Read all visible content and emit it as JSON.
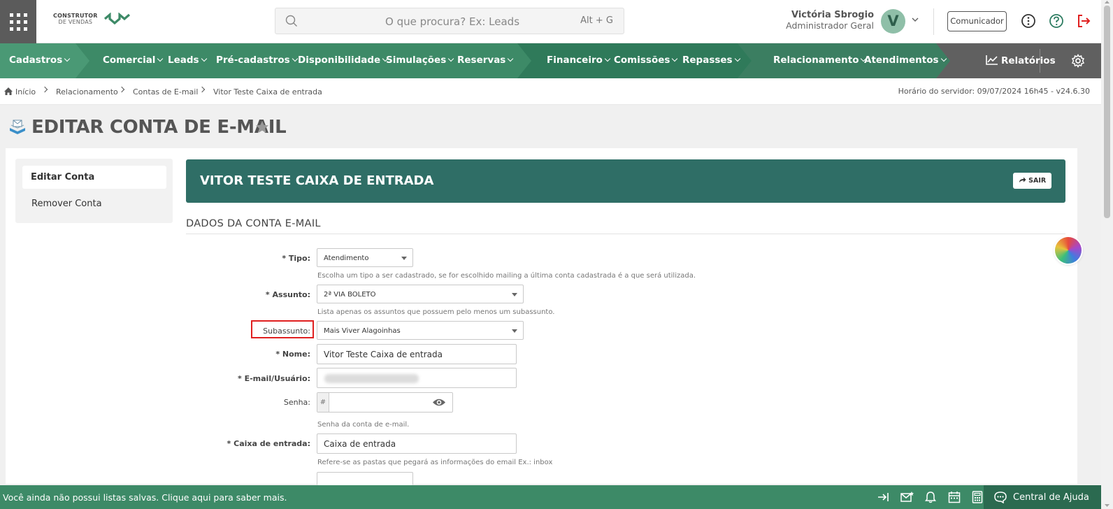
{
  "header": {
    "logo_line1": "CONSTRUTOR",
    "logo_line2": "DE VENDAS",
    "search_placeholder": "O que procura? Ex: Leads",
    "search_shortcut": "Alt + G",
    "user_name": "Victória Sbrogio",
    "user_role": "Administrador Geral",
    "avatar_initial": "V",
    "comunicador_label": "Comunicador"
  },
  "nav": {
    "items": [
      "Cadastros",
      "Comercial",
      "Leads",
      "Pré-cadastros",
      "Disponibilidade",
      "Simulações",
      "Reservas",
      "Financeiro",
      "Comissões",
      "Repasses",
      "Relacionamento",
      "Atendimentos"
    ],
    "reports_label": "Relatórios"
  },
  "breadcrumb": {
    "items": [
      "Início",
      "Relacionamento",
      "Contas de E-mail",
      "Vitor Teste Caixa de entrada"
    ],
    "server_time": "Horário do servidor: 09/07/2024 16h45 - v24.6.30"
  },
  "page": {
    "title": "EDITAR CONTA DE E-MAIL"
  },
  "sidemenu": {
    "active": "Editar Conta",
    "other": "Remover Conta"
  },
  "card": {
    "title": "VITOR TESTE CAIXA DE ENTRADA",
    "exit_label": "SAIR"
  },
  "form": {
    "section_title": "DADOS DA CONTA E-MAIL",
    "tipo_label": "* Tipo:",
    "tipo_value": "Atendimento",
    "tipo_hint": "Escolha um tipo a ser cadastrado, se for escolhido mailing a última conta cadastrada é a que será utilizada.",
    "assunto_label": "* Assunto:",
    "assunto_value": "2ª VIA BOLETO",
    "assunto_hint": "Lista apenas os assuntos que possuem pelo menos um subassunto.",
    "subassunto_label": "Subassunto:",
    "subassunto_value": "Mais Viver Alagoinhas",
    "nome_label": "* Nome:",
    "nome_value": "Vitor Teste Caixa de entrada",
    "email_label": "* E-mail/Usuário:",
    "senha_label": "Senha:",
    "senha_prefix": "#",
    "senha_hint": "Senha da conta de e-mail.",
    "caixa_label": "* Caixa de entrada:",
    "caixa_value": "Caixa de entrada",
    "caixa_hint": "Refere-se as pastas que pegará as informações do email Ex.: inbox"
  },
  "footer": {
    "message": "Você ainda não possui listas salvas. Clique aqui para saber mais.",
    "help_label": "Central de Ajuda"
  },
  "colors": {
    "nav_green": "#3d8a67",
    "card_teal": "#2f6e66",
    "highlight_red": "#e02020"
  }
}
